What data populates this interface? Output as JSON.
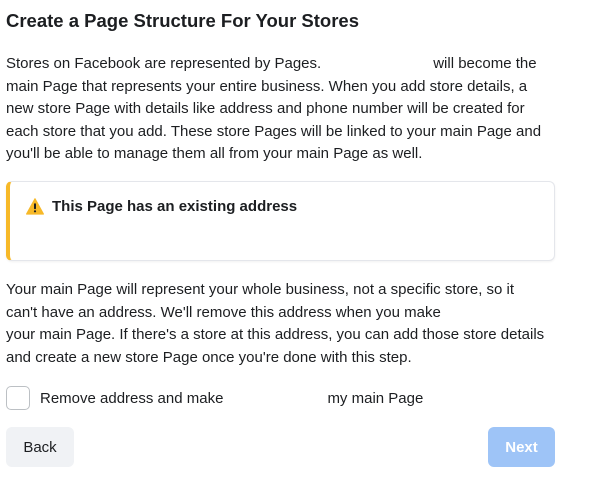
{
  "header": {
    "title": "Create a Page Structure For Your Stores"
  },
  "intro": {
    "line1_a": "Stores on Facebook are represented by Pages.",
    "line1_b": "will become the",
    "line2": "main Page that represents your entire business. When you add store details, a",
    "line3": "new store Page with details like address and phone number will be created for",
    "line4": "each store that you add. These store Pages will be linked to your main Page and",
    "line5": "you'll be able to manage them all from your main Page as well."
  },
  "warning": {
    "title": "This Page has an existing address",
    "icon": "warning-triangle-icon",
    "accent_color": "#f7b928"
  },
  "explain": {
    "line1": "Your main Page will represent your whole business, not a specific store, so it",
    "line2": "can't have an address. We'll remove this address when you make",
    "line3": "your main Page. If there's a store at this address, you can add those store details",
    "line4": "and create a new store Page once you're done with this step."
  },
  "checkbox": {
    "label_a": "Remove address and make",
    "label_b": "my main Page",
    "checked": false
  },
  "footer": {
    "back_label": "Back",
    "next_label": "Next",
    "next_enabled": false,
    "next_color": "#9ec4f7"
  }
}
